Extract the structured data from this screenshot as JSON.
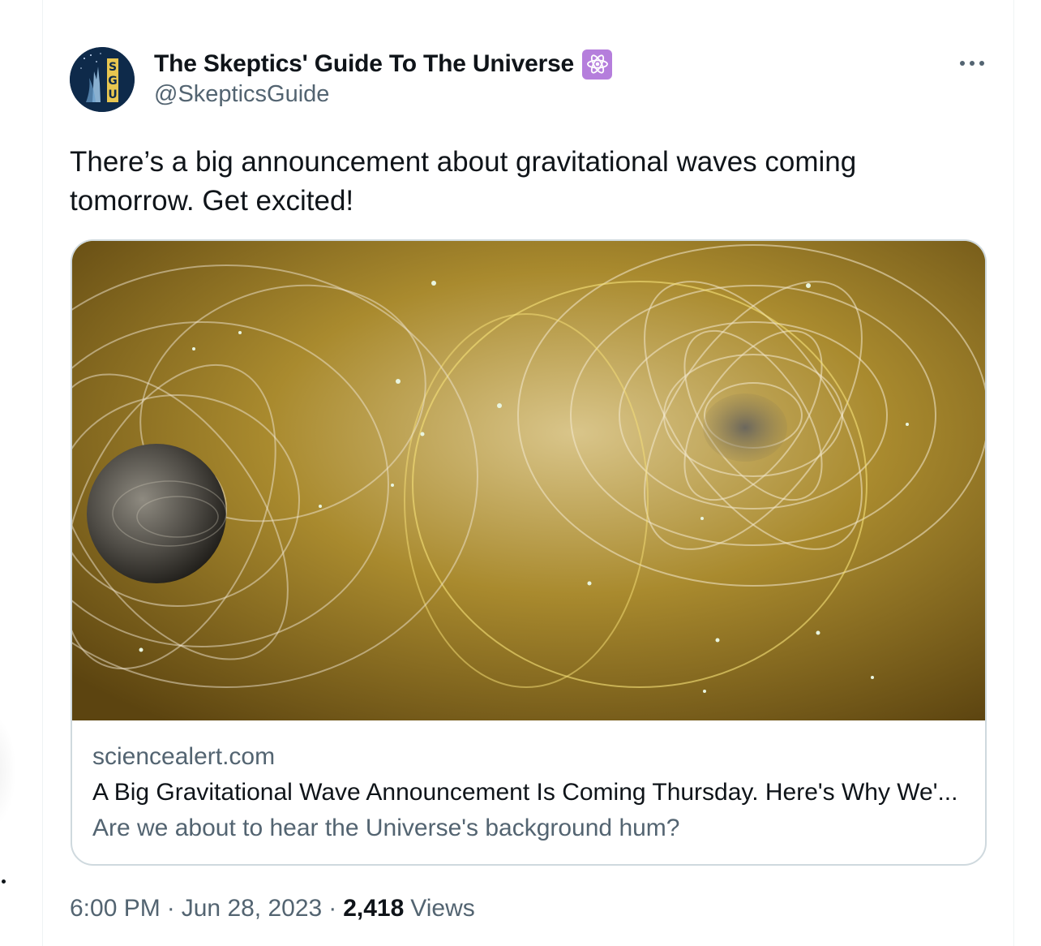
{
  "tweet": {
    "author": {
      "display_name": "The Skeptics' Guide To The Universe",
      "handle": "@SkepticsGuide",
      "avatar_letters": "SGU",
      "badge_icon": "atom-icon"
    },
    "text": "There’s a big announcement about gravitational waves coming tomorrow. Get excited!",
    "card": {
      "image_description_icon": "gravitational-waves-image",
      "domain": "sciencealert.com",
      "title": "A Big Gravitational Wave Announcement Is Coming Thursday. Here's Why We'...",
      "description": "Are we about to hear the Universe's background hum?"
    },
    "meta": {
      "time": "6:00 PM",
      "separator": "·",
      "date": "Jun 28, 2023",
      "views_count": "2,418",
      "views_label": "Views"
    }
  },
  "colors": {
    "text_primary": "#0f1419",
    "text_secondary": "#536471",
    "border": "#cfd9de",
    "badge_purple": "#b57edc",
    "avatar_bg": "#0e2a4a",
    "avatar_gold": "#e8c650"
  }
}
